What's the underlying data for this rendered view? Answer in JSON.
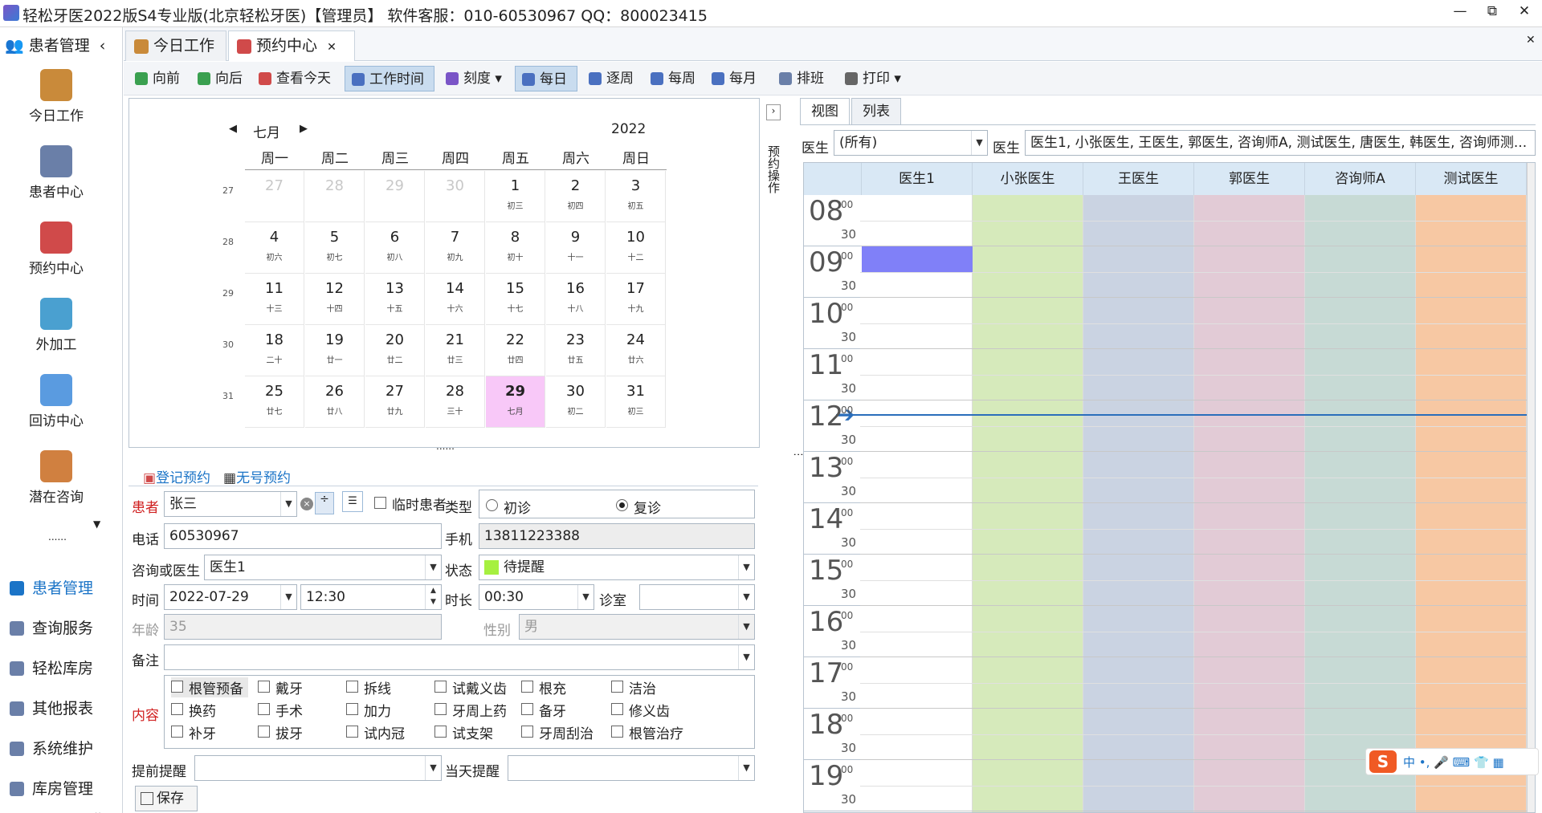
{
  "window": {
    "title": "轻松牙医2022版S4专业版(北京轻松牙医)【管理员】   软件客服：010-60530967 QQ：800023415",
    "min": "—",
    "restore": "⧉",
    "close": "✕"
  },
  "nav": {
    "header": "患者管理",
    "items": [
      {
        "label": "今日工作",
        "color": "#c98a3a"
      },
      {
        "label": "患者中心",
        "color": "#6a7fa8"
      },
      {
        "label": "预约中心",
        "color": "#d04a4a"
      },
      {
        "label": "外加工",
        "color": "#4aa0d0"
      },
      {
        "label": "回访中心",
        "color": "#5a9be0"
      },
      {
        "label": "潜在咨询",
        "color": "#d08040"
      }
    ],
    "groups": [
      {
        "label": "患者管理",
        "color": "#1b74c7"
      },
      {
        "label": "查询服务"
      },
      {
        "label": "轻松库房"
      },
      {
        "label": "其他报表"
      },
      {
        "label": "系统维护"
      },
      {
        "label": "库房管理"
      }
    ]
  },
  "tabs": [
    {
      "label": "今日工作"
    },
    {
      "label": "预约中心",
      "close": "✕"
    }
  ],
  "tabs_close_all": "✕",
  "toolbar": [
    {
      "label": "向前"
    },
    {
      "label": "向后"
    },
    {
      "label": "查看今天"
    },
    {
      "label": "工作时间",
      "selected": true
    },
    {
      "label": "刻度 ▾"
    },
    {
      "label": "每日",
      "selected": true
    },
    {
      "label": "逐周"
    },
    {
      "label": "每周"
    },
    {
      "label": "每月"
    },
    {
      "label": "排班"
    },
    {
      "label": "打印 ▾"
    }
  ],
  "calendar": {
    "month": "七月",
    "year": "2022",
    "prev": "◀",
    "next": "▶",
    "weekdays": [
      "周一",
      "周二",
      "周三",
      "周四",
      "周五",
      "周六",
      "周日"
    ],
    "weeks": [
      "27",
      "28",
      "29",
      "30",
      "31"
    ],
    "rows": [
      [
        [
          "27",
          ""
        ],
        [
          "28",
          ""
        ],
        [
          "29",
          ""
        ],
        [
          "30",
          ""
        ],
        [
          "1",
          "初三"
        ],
        [
          "2",
          "初四"
        ],
        [
          "3",
          "初五"
        ]
      ],
      [
        [
          "4",
          "初六"
        ],
        [
          "5",
          "初七"
        ],
        [
          "6",
          "初八"
        ],
        [
          "7",
          "初九"
        ],
        [
          "8",
          "初十"
        ],
        [
          "9",
          "十一"
        ],
        [
          "10",
          "十二"
        ]
      ],
      [
        [
          "11",
          "十三"
        ],
        [
          "12",
          "十四"
        ],
        [
          "13",
          "十五"
        ],
        [
          "14",
          "十六"
        ],
        [
          "15",
          "十七"
        ],
        [
          "16",
          "十八"
        ],
        [
          "17",
          "十九"
        ]
      ],
      [
        [
          "18",
          "二十"
        ],
        [
          "19",
          "廿一"
        ],
        [
          "20",
          "廿二"
        ],
        [
          "21",
          "廿三"
        ],
        [
          "22",
          "廿四"
        ],
        [
          "23",
          "廿五"
        ],
        [
          "24",
          "廿六"
        ]
      ],
      [
        [
          "25",
          "廿七"
        ],
        [
          "26",
          "廿八"
        ],
        [
          "27",
          "廿九"
        ],
        [
          "28",
          "三十"
        ],
        [
          "29",
          "七月"
        ],
        [
          "30",
          "初二"
        ],
        [
          "31",
          "初三"
        ]
      ]
    ],
    "today": "29"
  },
  "side_tab": "预约操作",
  "form": {
    "register": "登记预约",
    "noreg": "无号预约",
    "patient_lbl": "患者",
    "patient": "张三",
    "temp": "临时患者",
    "type_lbl": "类型",
    "first": "初诊",
    "revisit": "复诊",
    "phone_lbl": "电话",
    "phone": "60530967",
    "mobile_lbl": "手机",
    "mobile": "13811223388",
    "doctor_lbl": "咨询或医生",
    "doctor": "医生1",
    "status_lbl": "状态",
    "status": "待提醒",
    "status_color": "#a6f040",
    "time_lbl": "时间",
    "date": "2022-07-29",
    "time": "12:30",
    "dur_lbl": "时长",
    "dur": "00:30",
    "room_lbl": "诊室",
    "age_lbl": "年龄",
    "age": "35",
    "sex_lbl": "性别",
    "sex": "男",
    "note_lbl": "备注",
    "content_lbl": "内容",
    "content": [
      "根管预备",
      "戴牙",
      "拆线",
      "试戴义齿",
      "根充",
      "洁治",
      "换药",
      "手术",
      "加力",
      "牙周上药",
      "备牙",
      "修义齿",
      "补牙",
      "拔牙",
      "试内冠",
      "试支架",
      "牙周刮治",
      "根管治疗"
    ],
    "pre_lbl": "提前提醒",
    "day_lbl": "当天提醒",
    "save": "保存"
  },
  "view": {
    "tab1": "视图",
    "tab2": "列表",
    "doc_lbl": "医生",
    "doc_sel": "(所有)",
    "doc_lbl2": "医生",
    "doc_list": "医生1, 小张医生, 王医生, 郭医生, 咨询师A, 测试医生, 唐医生, 韩医生, 咨询师测...",
    "columns": [
      {
        "name": "医生1",
        "color": "#ffffff"
      },
      {
        "name": "小张医生",
        "color": "#d6eabb"
      },
      {
        "name": "王医生",
        "color": "#cad3e2"
      },
      {
        "name": "郭医生",
        "color": "#e2cbd6"
      },
      {
        "name": "咨询师A",
        "color": "#c7dad5"
      },
      {
        "name": "测试医生",
        "color": "#f7c8a3"
      }
    ],
    "hours": [
      "08",
      "09",
      "10",
      "11",
      "12",
      "13",
      "14",
      "15",
      "16",
      "17",
      "18",
      "19"
    ],
    "min00": "00",
    "min30": "30",
    "appt_color": "#8080f8",
    "arrow": "➔"
  },
  "ime": {
    "logo": "S",
    "text": "中 •, 🎤 ⌨ 👕 ▦"
  }
}
